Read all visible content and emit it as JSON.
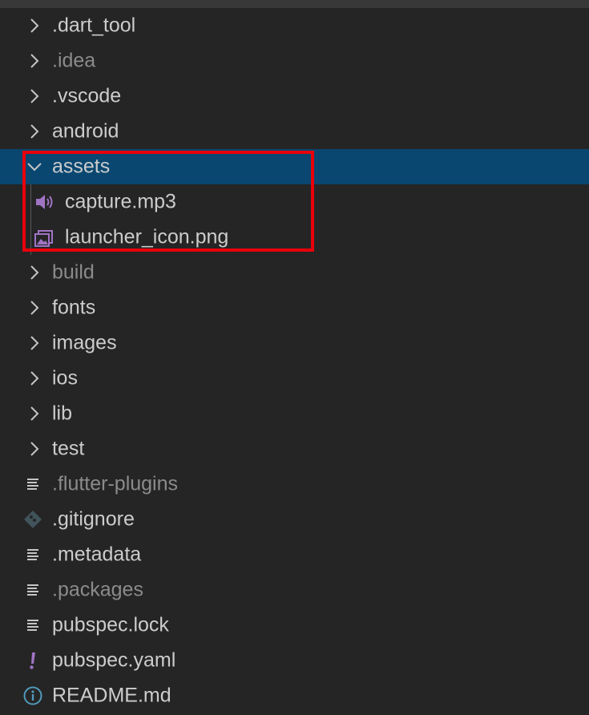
{
  "explorer": {
    "items": [
      {
        "label": ".dart_tool",
        "kind": "folder",
        "expanded": false,
        "dim": false
      },
      {
        "label": ".idea",
        "kind": "folder",
        "expanded": false,
        "dim": true
      },
      {
        "label": ".vscode",
        "kind": "folder",
        "expanded": false,
        "dim": false
      },
      {
        "label": "android",
        "kind": "folder",
        "expanded": false,
        "dim": false
      },
      {
        "label": "assets",
        "kind": "folder",
        "expanded": true,
        "selected": true,
        "dim": false
      },
      {
        "label": "capture.mp3",
        "kind": "audio-file",
        "child": true,
        "dim": false
      },
      {
        "label": "launcher_icon.png",
        "kind": "image-file",
        "child": true,
        "dim": false
      },
      {
        "label": "build",
        "kind": "folder",
        "expanded": false,
        "dim": true
      },
      {
        "label": "fonts",
        "kind": "folder",
        "expanded": false,
        "dim": false
      },
      {
        "label": "images",
        "kind": "folder",
        "expanded": false,
        "dim": false
      },
      {
        "label": "ios",
        "kind": "folder",
        "expanded": false,
        "dim": false
      },
      {
        "label": "lib",
        "kind": "folder",
        "expanded": false,
        "dim": false
      },
      {
        "label": "test",
        "kind": "folder",
        "expanded": false,
        "dim": false
      },
      {
        "label": ".flutter-plugins",
        "kind": "text-file",
        "dim": true
      },
      {
        "label": ".gitignore",
        "kind": "git-file",
        "dim": false
      },
      {
        "label": ".metadata",
        "kind": "text-file",
        "dim": false
      },
      {
        "label": ".packages",
        "kind": "text-file",
        "dim": true
      },
      {
        "label": "pubspec.lock",
        "kind": "text-file",
        "dim": false
      },
      {
        "label": "pubspec.yaml",
        "kind": "yaml-file",
        "dim": false
      },
      {
        "label": "README.md",
        "kind": "info-file",
        "dim": false
      }
    ]
  },
  "colors": {
    "background": "#252526",
    "selection": "#094771",
    "text": "#cccccc",
    "dim_text": "#8b8b8b",
    "icon": "#c5c5c5",
    "media_icon": "#a074c4",
    "highlight_box": "#e8000b",
    "info_icon": "#519aba"
  }
}
